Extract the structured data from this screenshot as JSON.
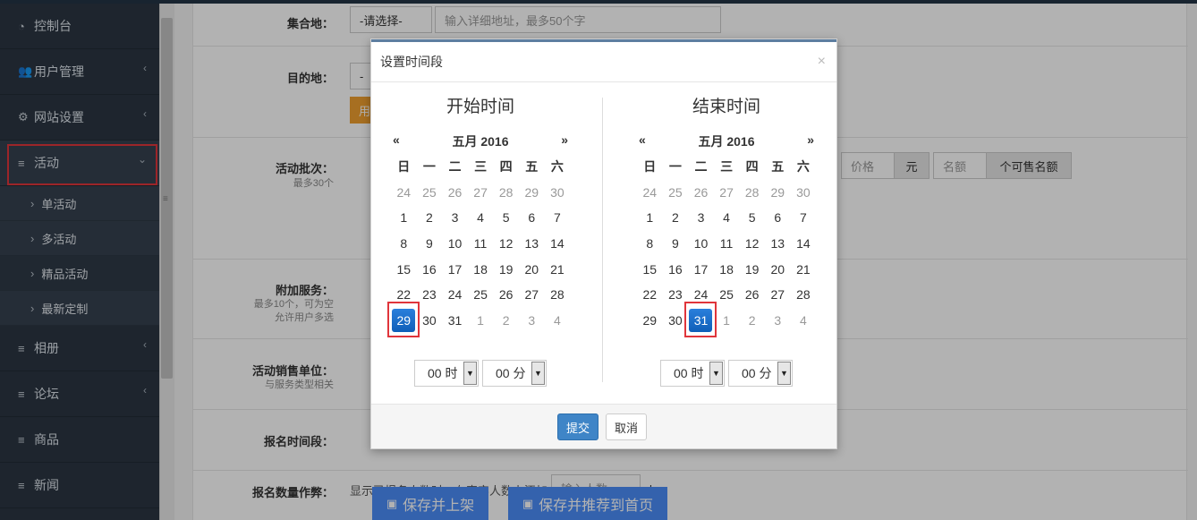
{
  "sidebar": {
    "items": [
      {
        "label": "控制台"
      },
      {
        "label": "用户管理"
      },
      {
        "label": "网站设置"
      },
      {
        "label": "活动"
      },
      {
        "label": "相册"
      },
      {
        "label": "论坛"
      },
      {
        "label": "商品"
      },
      {
        "label": "新闻"
      }
    ],
    "subitems": [
      {
        "label": "单活动"
      },
      {
        "label": "多活动"
      },
      {
        "label": "精品活动"
      },
      {
        "label": "最新定制"
      }
    ]
  },
  "form": {
    "gather_label": "集合地：",
    "gather_select": "-请选择-",
    "gather_placeholder": "输入详细地址，最多50个字",
    "dest_label": "目的地：",
    "dest_select_partial": "-",
    "orange_btn_partial": "用",
    "batch_label": "活动批次：",
    "batch_hint": "最多30个",
    "price_placeholder": "价格",
    "price_unit": "元",
    "quota_placeholder": "名额",
    "quota_unit": "个可售名额",
    "extra_label": "附加服务：",
    "extra_hint_1": "最多10个，可为空",
    "extra_hint_2": "允许用户多选",
    "sales_unit_label": "活动销售单位：",
    "sales_unit_hint": "与服务类型相关",
    "signup_period_label": "报名时间段：",
    "signup_count_label": "报名数量作弊：",
    "signup_count_text": "显示已报名人数时，在真实人数上添加",
    "signup_count_placeholder": "输入人数",
    "signup_count_unit": "人",
    "save_publish": "保存并上架",
    "save_recommend": "保存并推荐到首页"
  },
  "modal": {
    "title": "设置时间段",
    "close": "×",
    "start": {
      "title": "开始时间",
      "prev": "«",
      "next": "»",
      "month": "五月 2016",
      "weekdays": [
        "日",
        "一",
        "二",
        "三",
        "四",
        "五",
        "六"
      ],
      "days": [
        "24",
        "25",
        "26",
        "27",
        "28",
        "29",
        "30",
        "1",
        "2",
        "3",
        "4",
        "5",
        "6",
        "7",
        "8",
        "9",
        "10",
        "11",
        "12",
        "13",
        "14",
        "15",
        "16",
        "17",
        "18",
        "19",
        "20",
        "21",
        "22",
        "23",
        "24",
        "25",
        "26",
        "27",
        "28",
        "29",
        "30",
        "31",
        "1",
        "2",
        "3",
        "4"
      ],
      "selected_day": "29",
      "hour": "00 时",
      "minute": "00 分"
    },
    "end": {
      "title": "结束时间",
      "prev": "«",
      "next": "»",
      "month": "五月 2016",
      "weekdays": [
        "日",
        "一",
        "二",
        "三",
        "四",
        "五",
        "六"
      ],
      "days": [
        "24",
        "25",
        "26",
        "27",
        "28",
        "29",
        "30",
        "1",
        "2",
        "3",
        "4",
        "5",
        "6",
        "7",
        "8",
        "9",
        "10",
        "11",
        "12",
        "13",
        "14",
        "15",
        "16",
        "17",
        "18",
        "19",
        "20",
        "21",
        "22",
        "23",
        "24",
        "25",
        "26",
        "27",
        "28",
        "29",
        "30",
        "31",
        "1",
        "2",
        "3",
        "4"
      ],
      "selected_day": "31",
      "hour": "00 时",
      "minute": "00 分"
    },
    "submit": "提交",
    "cancel": "取消"
  }
}
